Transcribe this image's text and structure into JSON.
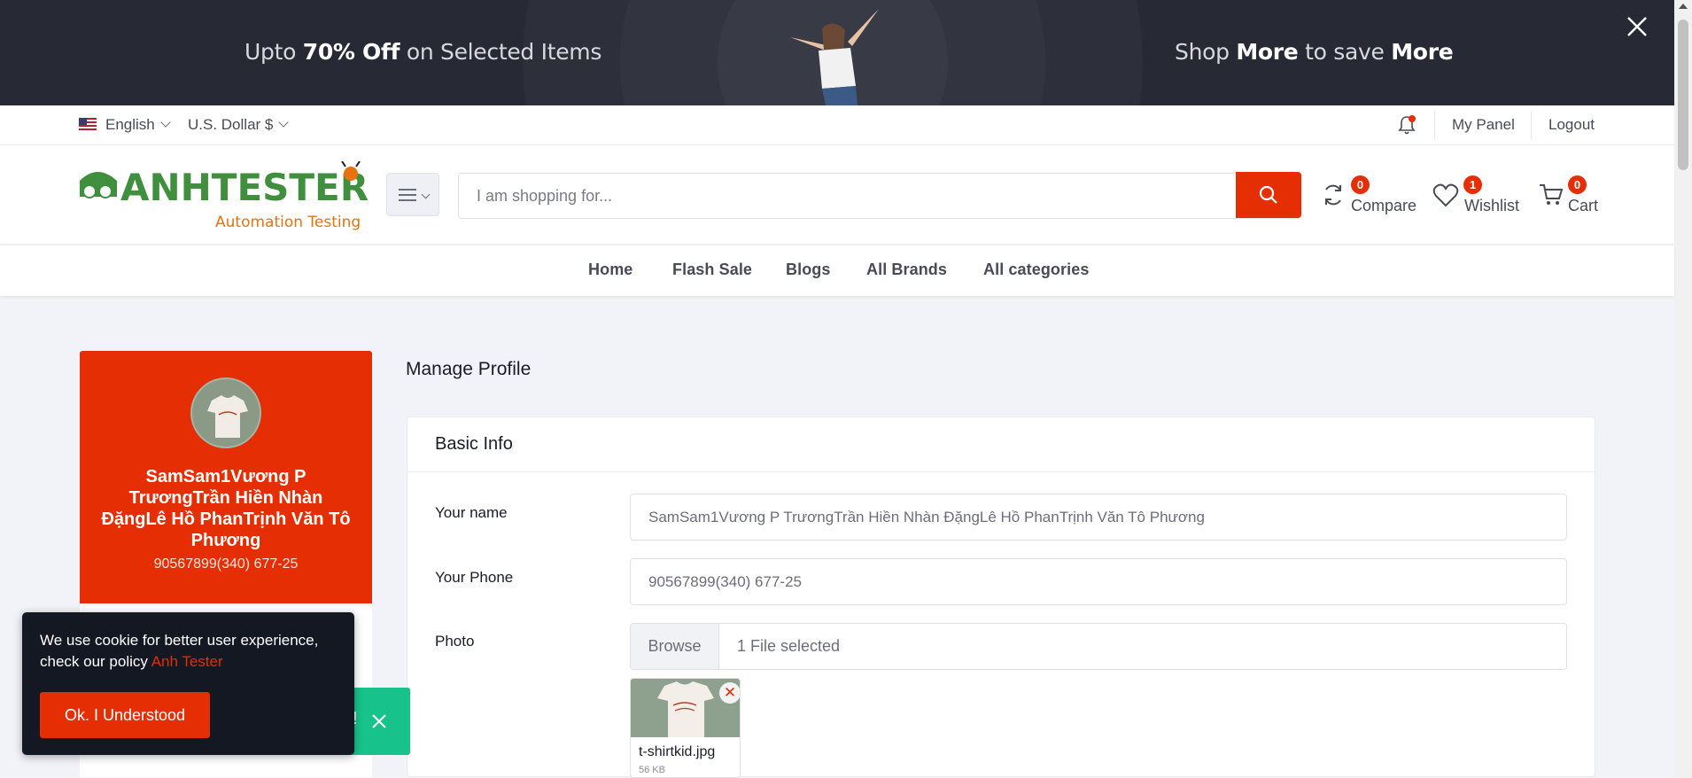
{
  "banner": {
    "left_prefix": "Upto ",
    "left_bold": "70% Off",
    "left_suffix": " on Selected Items",
    "right_prefix": "Shop ",
    "right_bold1": "More",
    "right_mid": " to save ",
    "right_bold2": "More"
  },
  "topbar": {
    "language": "English",
    "currency": "U.S. Dollar $",
    "my_panel": "My Panel",
    "logout": "Logout"
  },
  "header": {
    "logo_main": "ANHTESTER",
    "logo_sub": "Automation Testing",
    "search_placeholder": "I am shopping for...",
    "compare_label": "Compare",
    "compare_count": "0",
    "wishlist_label": "Wishlist",
    "wishlist_count": "1",
    "cart_label": "Cart",
    "cart_count": "0"
  },
  "nav": [
    "Home",
    "Flash Sale",
    "Blogs",
    "All Brands",
    "All categories"
  ],
  "sidebar": {
    "name": "SamSam1Vương P TrươngTrần Hiền Nhàn ĐặngLê Hồ PhanTrịnh Văn Tô Phương",
    "phone": "90567899(340) 677-25"
  },
  "main": {
    "page_title": "Manage Profile",
    "card_title": "Basic Info",
    "name_label": "Your name",
    "name_value": "SamSam1Vương  P TrươngTrần Hiền Nhàn ĐặngLê Hồ PhanTrịnh Văn Tô  Phương",
    "phone_label": "Your Phone",
    "phone_value": "90567899(340) 677-25",
    "photo_label": "Photo",
    "browse_label": "Browse",
    "file_selected": "1 File selected",
    "file_name": "t-shirtkid.jpg",
    "file_size": "56 KB"
  },
  "toast": {
    "text": "!"
  },
  "cookie": {
    "text": "We use cookie for better user experience, check our policy ",
    "policy_link": "Anh Tester",
    "button": "Ok. I Understood"
  },
  "colors": {
    "accent": "#e62e04",
    "banner_bg": "#272935",
    "toast": "#18c38b",
    "cookie_bg": "#141823"
  }
}
